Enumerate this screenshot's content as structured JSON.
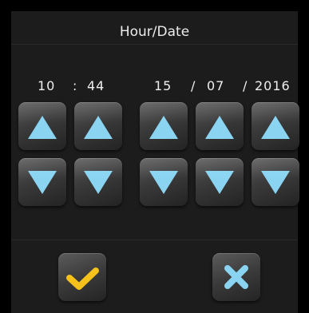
{
  "header": {
    "title": "Hour/Date"
  },
  "time": {
    "hour": "10",
    "separator": ":",
    "minute": "44"
  },
  "date": {
    "day": "15",
    "sep1": "/",
    "month": "07",
    "sep2": "/",
    "year": "2016"
  },
  "icons": {
    "up": "arrow-up-icon",
    "down": "arrow-down-icon",
    "confirm": "checkmark-icon",
    "cancel": "close-icon"
  },
  "colors": {
    "arrow": "#8ad4f2",
    "confirm": "#f5c21b",
    "cancel": "#8ad4f2",
    "text": "#efefef"
  }
}
